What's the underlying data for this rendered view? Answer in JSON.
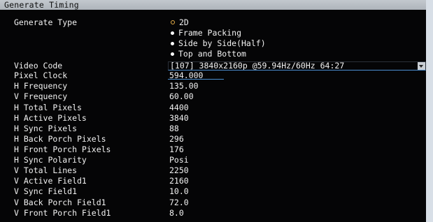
{
  "window": {
    "title": "Generate Timing"
  },
  "generate_type": {
    "label": "Generate Type",
    "options": [
      {
        "label": "2D",
        "selected": true
      },
      {
        "label": "Frame Packing",
        "selected": false
      },
      {
        "label": "Side by Side(Half)",
        "selected": false
      },
      {
        "label": "Top and Bottom",
        "selected": false
      }
    ]
  },
  "video_code": {
    "label": "Video Code",
    "value": "[107] 3840x2160p @59.94Hz/60Hz 64:27"
  },
  "pixel_clock": {
    "label": "Pixel Clock",
    "value": "594.000"
  },
  "fields": [
    {
      "label": "H Frequency",
      "value": "135.00"
    },
    {
      "label": "V Frequency",
      "value": "60.00"
    },
    {
      "label": "H Total Pixels",
      "value": "4400"
    },
    {
      "label": "H Active Pixels",
      "value": "3840"
    },
    {
      "label": "H Sync Pixels",
      "value": "88"
    },
    {
      "label": "H Back Porch Pixels",
      "value": "296"
    },
    {
      "label": "H Front Porch Pixels",
      "value": "176"
    },
    {
      "label": "H Sync Polarity",
      "value": "Posi"
    },
    {
      "label": "V Total Lines",
      "value": "2250"
    },
    {
      "label": "V Active Field1",
      "value": "2160"
    },
    {
      "label": "V Sync Field1",
      "value": "10.0"
    },
    {
      "label": "V Back Porch Field1",
      "value": "72.0"
    },
    {
      "label": "V Front Porch Field1",
      "value": "8.0"
    }
  ],
  "colors": {
    "background": "#050506",
    "text": "#f2f2f2",
    "radio_selected": "#e8b04a",
    "focus_underline": "#4c8fd1"
  }
}
